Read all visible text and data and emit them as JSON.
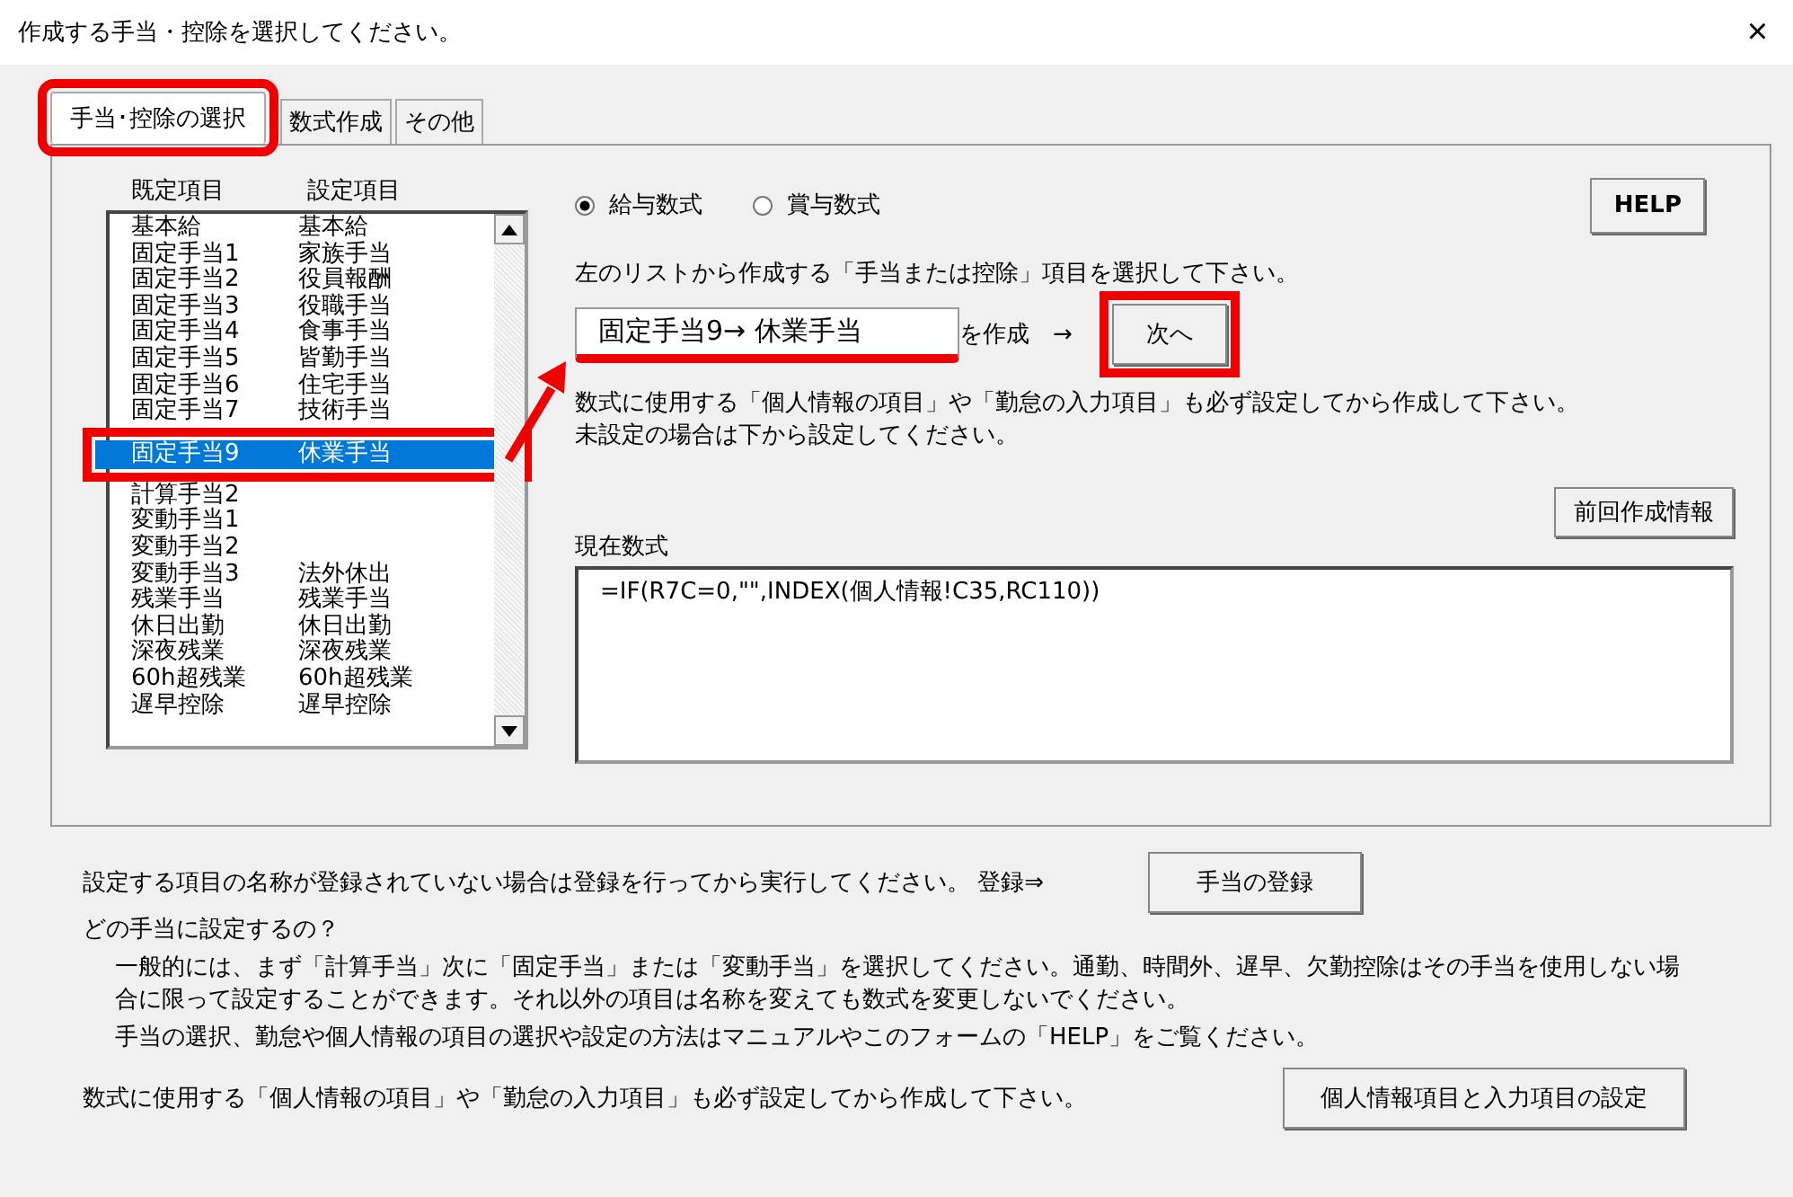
{
  "window": {
    "title": "作成する手当・控除を選択してください。",
    "close": "×"
  },
  "tabs": [
    {
      "label": "手当･控除の選択",
      "selected": true
    },
    {
      "label": "数式作成",
      "selected": false
    },
    {
      "label": "その他",
      "selected": false
    }
  ],
  "list": {
    "columns": [
      "既定項目",
      "設定項目"
    ],
    "rows": [
      {
        "default": "基本給",
        "setting": "基本給",
        "selected": false
      },
      {
        "default": "固定手当1",
        "setting": "家族手当",
        "selected": false
      },
      {
        "default": "固定手当2",
        "setting": "役員報酬",
        "selected": false
      },
      {
        "default": "固定手当3",
        "setting": "役職手当",
        "selected": false
      },
      {
        "default": "固定手当4",
        "setting": "食事手当",
        "selected": false
      },
      {
        "default": "固定手当5",
        "setting": "皆勤手当",
        "selected": false
      },
      {
        "default": "固定手当6",
        "setting": "住宅手当",
        "selected": false
      },
      {
        "default": "固定手当7",
        "setting": "技術手当",
        "selected": false
      },
      {
        "default": "固定手当9",
        "setting": "休業手当",
        "selected": true
      },
      {
        "default": "計算手当2",
        "setting": "",
        "selected": false
      },
      {
        "default": "変動手当1",
        "setting": "",
        "selected": false
      },
      {
        "default": "変動手当2",
        "setting": "",
        "selected": false
      },
      {
        "default": "変動手当3",
        "setting": "法外休出",
        "selected": false
      },
      {
        "default": "残業手当",
        "setting": "残業手当",
        "selected": false
      },
      {
        "default": "休日出勤",
        "setting": "休日出勤",
        "selected": false
      },
      {
        "default": "深夜残業",
        "setting": "深夜残業",
        "selected": false
      },
      {
        "default": "60h超残業",
        "setting": "60h超残業",
        "selected": false
      },
      {
        "default": "遅早控除",
        "setting": "遅早控除",
        "selected": false
      }
    ]
  },
  "formula_type": [
    {
      "label": "給与数式",
      "selected": true
    },
    {
      "label": "賞与数式",
      "selected": false
    }
  ],
  "help_button": "HELP",
  "instruction": "左のリストから作成する「手当または控除」項目を選択して下さい。",
  "selected_item": "固定手当9→ 休業手当",
  "create_label": "を作成　→",
  "next_button": "次へ",
  "note": [
    "数式に使用する「個人情報の項目」や「勤怠の入力項目」も必ず設定してから作成して下さい。",
    "未設定の場合は下から設定してください。"
  ],
  "previous_info_button": "前回作成情報",
  "current_formula": {
    "label": "現在数式",
    "value": "=IF(R7C=0,\"\",INDEX(個人情報!C35,RC110))"
  },
  "register_text": "設定する項目の名称が登録されていない場合は登録を行ってから実行してください。 登録⇒",
  "register_button": "手当の登録",
  "faq_title": "どの手当に設定するの？",
  "faq_lines": [
    "一般的には、まず「計算手当」次に「固定手当」または「変動手当」を選択してください。通勤、時間外、遅早、欠勤控除はその手当を使用しない場合に限って設定することができます。それ以外の項目は名称を変えても数式を変更しないでください。",
    "手当の選択、勤怠や個人情報の項目の選択や設定の方法はマニュアルやこのフォームの「HELP」をご覧ください。"
  ],
  "footer_text": "数式に使用する「個人情報の項目」や「勤怠の入力項目」も必ず設定してから作成して下さい。",
  "settings_button": "個人情報項目と入力項目の設定"
}
